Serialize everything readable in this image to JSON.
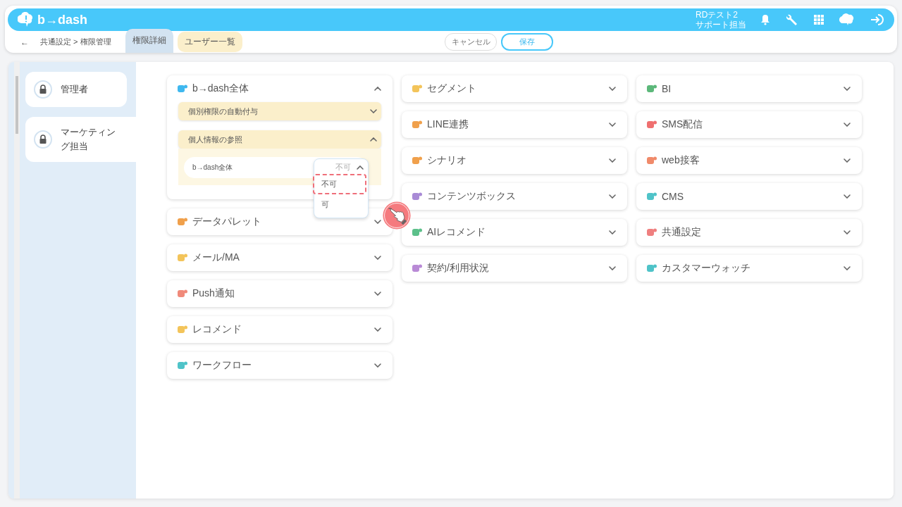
{
  "header": {
    "logo": "b→dash",
    "user_name": "RDテスト2",
    "user_role": "サポート担当"
  },
  "toolbar": {
    "back": "←",
    "breadcrumb": "共通設定 > 権限管理",
    "tabs": [
      {
        "label": "権限詳細",
        "selected": true
      },
      {
        "label": "ユーザー一覧",
        "selected": false
      }
    ],
    "buttons": [
      {
        "label": "キャンセル",
        "kind": "secondary"
      },
      {
        "label": "保存",
        "kind": "primary"
      }
    ]
  },
  "sidebar": {
    "items": [
      {
        "label": "管理者",
        "selected": false
      },
      {
        "label": "マーケティング担当",
        "selected": true
      }
    ]
  },
  "columns": [
    [
      {
        "title": "b→dash全体",
        "color": "#3fb8ef",
        "expanded": true,
        "subsections": [
          {
            "title": "個別権限の自動付与",
            "expanded": false
          },
          {
            "title": "個人情報の参照",
            "expanded": true,
            "rows": [
              {
                "label": "b→dash全体",
                "value": "不可",
                "open": true,
                "options": [
                  {
                    "label": "不可",
                    "highlighted": true
                  },
                  {
                    "label": "可",
                    "highlighted": false
                  }
                ]
              }
            ]
          }
        ]
      },
      {
        "title": "データパレット",
        "color": "#f0a04b",
        "expanded": false
      },
      {
        "title": "メール/MA",
        "color": "#f3c45a",
        "expanded": false
      },
      {
        "title": "Push通知",
        "color": "#f08a7a",
        "expanded": false
      },
      {
        "title": "レコメンド",
        "color": "#f3c45a",
        "expanded": false
      },
      {
        "title": "ワークフロー",
        "color": "#4fc3c8",
        "expanded": false
      }
    ],
    [
      {
        "title": "セグメント",
        "color": "#f3c45a",
        "expanded": false
      },
      {
        "title": "LINE連携",
        "color": "#f0a04b",
        "expanded": false
      },
      {
        "title": "シナリオ",
        "color": "#f0a04b",
        "expanded": false
      },
      {
        "title": "コンテンツボックス",
        "color": "#a98bd6",
        "expanded": false
      },
      {
        "title": "AIレコメンド",
        "color": "#5cc08a",
        "expanded": false
      },
      {
        "title": "契約/利用状況",
        "color": "#b98ad6",
        "expanded": false
      }
    ],
    [
      {
        "title": "BI",
        "color": "#5cb87a",
        "expanded": false
      },
      {
        "title": "SMS配信",
        "color": "#ef6f6f",
        "expanded": false
      },
      {
        "title": "web接客",
        "color": "#f08a6a",
        "expanded": false
      },
      {
        "title": "CMS",
        "color": "#4fc3c8",
        "expanded": false
      },
      {
        "title": "共通設定",
        "color": "#ef7f7f",
        "expanded": false
      },
      {
        "title": "カスタマーウォッチ",
        "color": "#4fc3c8",
        "expanded": false
      }
    ]
  ]
}
